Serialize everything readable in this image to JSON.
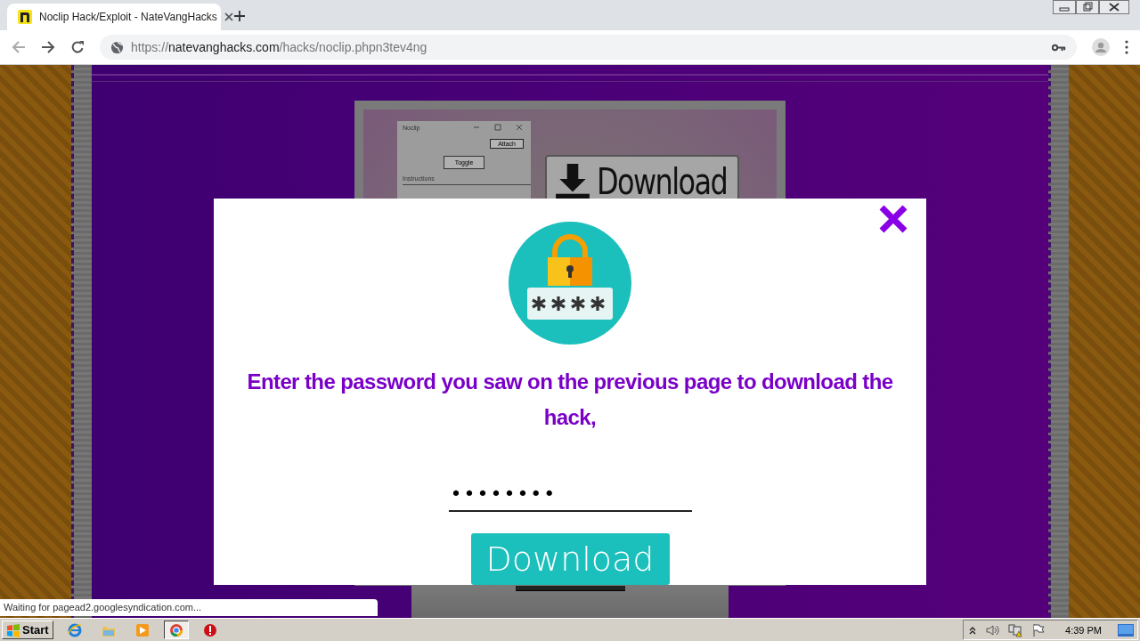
{
  "browser": {
    "tab": {
      "title": "Noclip Hack/Exploit - NateVangHacks"
    },
    "url": {
      "scheme": "https://",
      "host": "natevanghacks.com",
      "path": "/hacks/noclip.phpn3tev4ng"
    }
  },
  "page": {
    "preview": {
      "window_title": "Noclip",
      "attach": "Attach",
      "toggle": "Toggle",
      "label": "Instructions",
      "download": "Download"
    }
  },
  "modal": {
    "heading": "Enter the password you saw on the previous page to download the hack,",
    "password": {
      "value": "••••••••"
    },
    "button": "Download"
  },
  "status_bubble": "Waiting for pagead2.googlesyndication.com...",
  "taskbar": {
    "start": "Start",
    "apps": [
      {
        "kind": "ie",
        "selected": false
      },
      {
        "kind": "folder",
        "selected": false
      },
      {
        "kind": "media",
        "selected": false
      },
      {
        "kind": "chrome",
        "selected": true
      },
      {
        "kind": "opera",
        "selected": false
      }
    ],
    "clock": "4:39 PM"
  }
}
